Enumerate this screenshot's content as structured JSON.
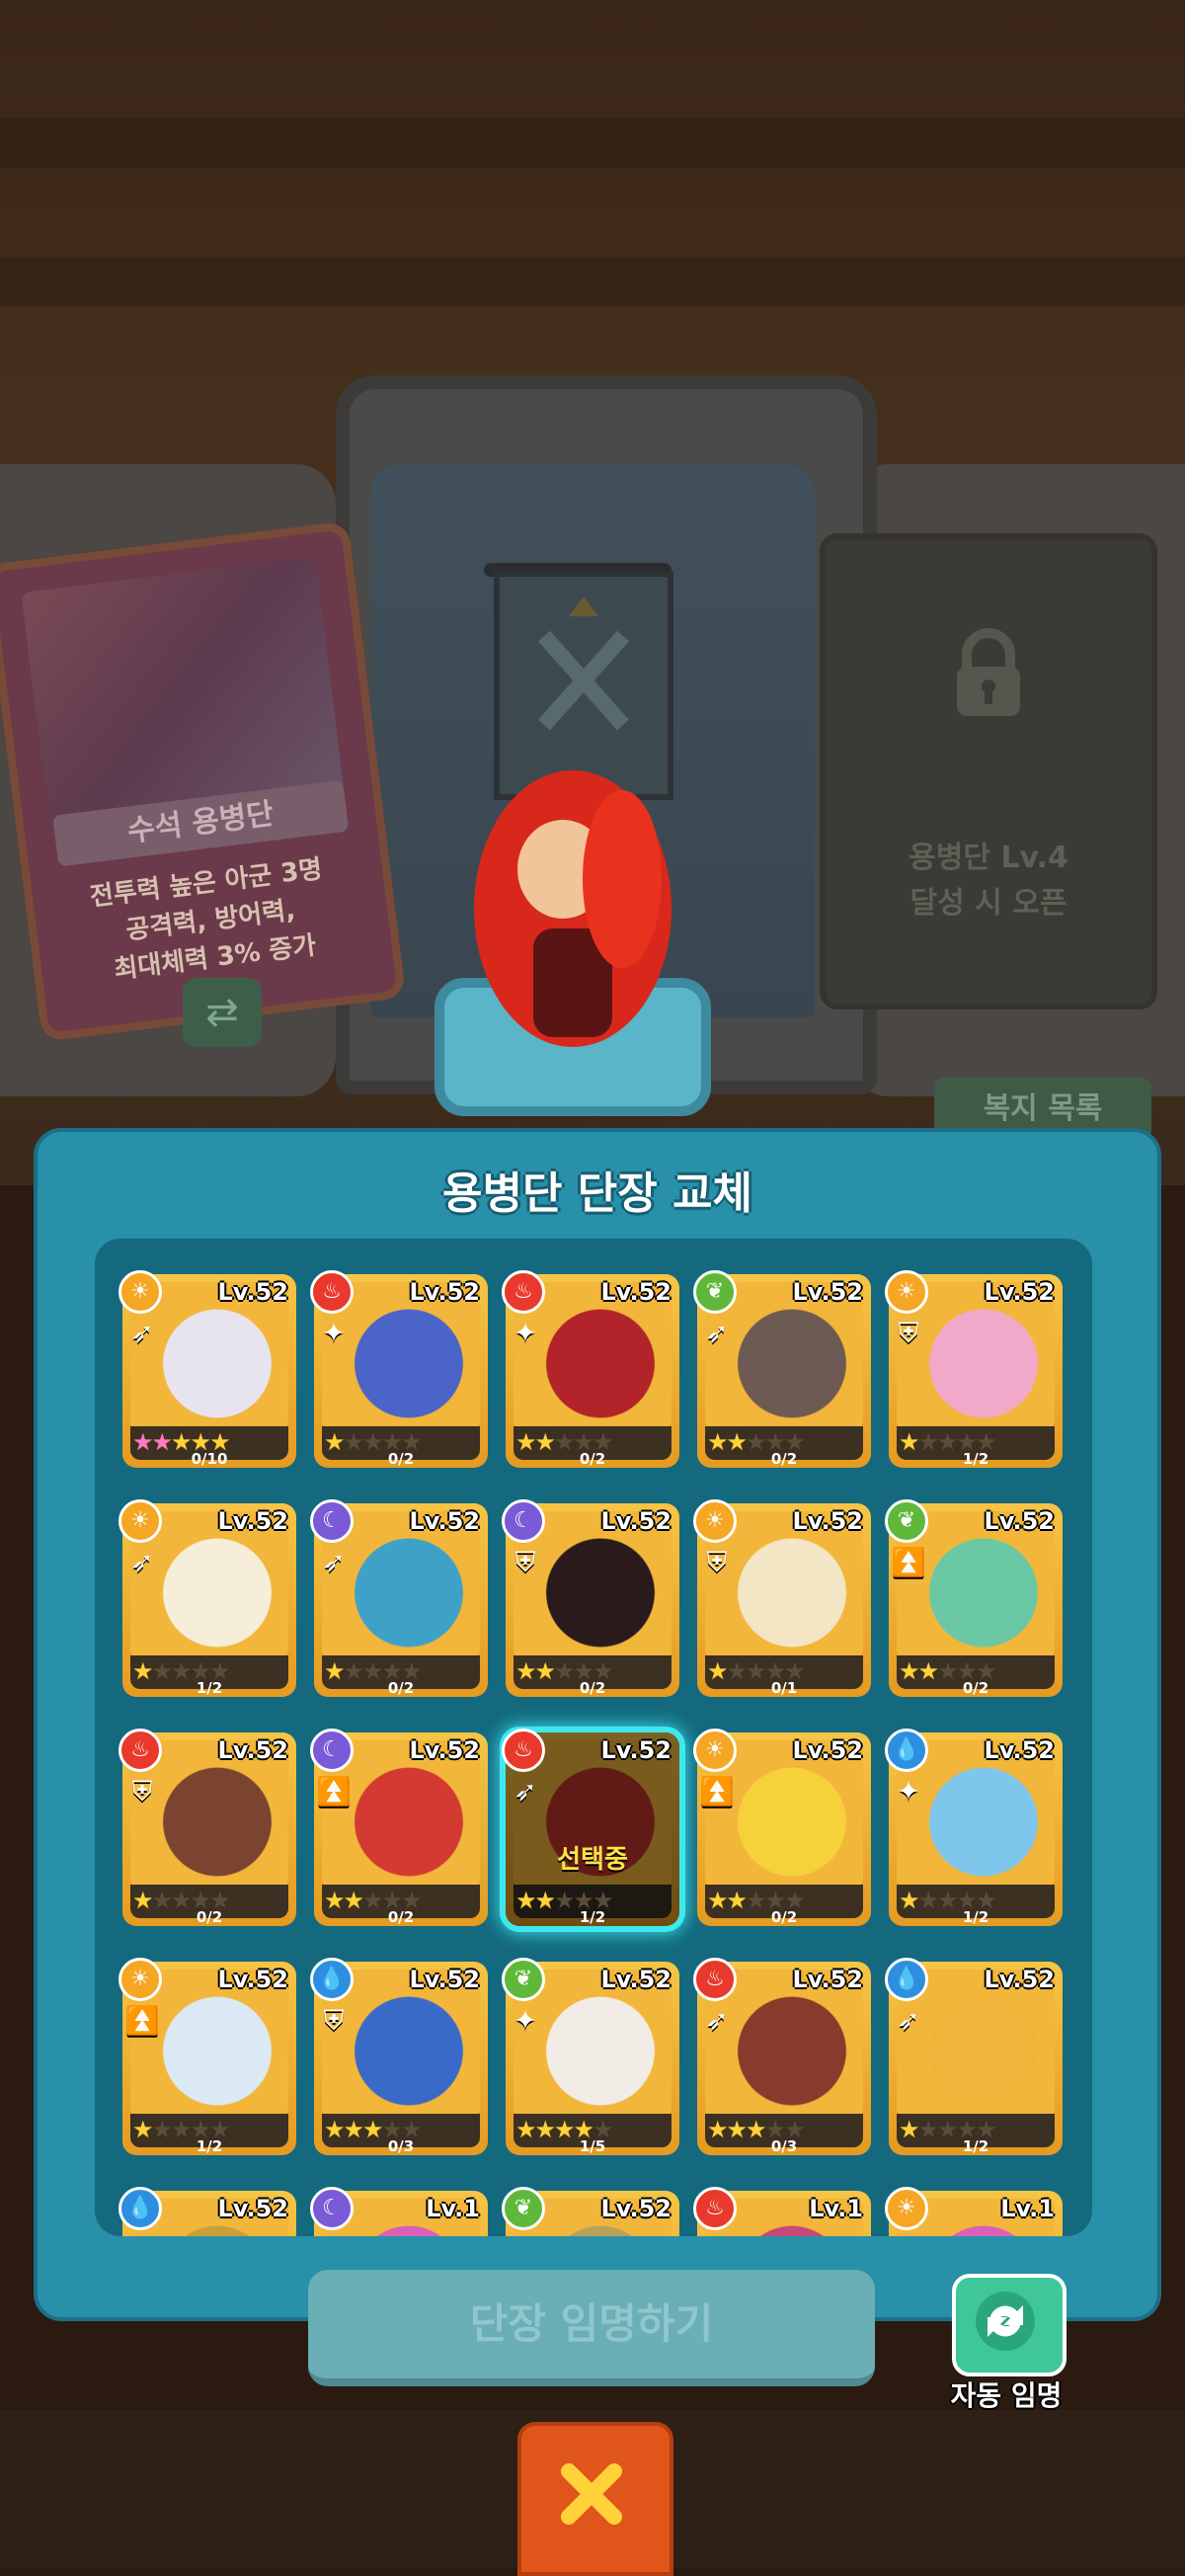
{
  "background": {
    "left_card": {
      "title": "수석 용병단",
      "desc_lines": [
        "전투력 높은 아군 3명",
        "공격력, 방어력,",
        "최대체력 3% 증가"
      ]
    },
    "right_card": {
      "lines": [
        "용병단 Lv.4",
        "달성 시 오픈"
      ]
    },
    "support_list_label": "복지 목록"
  },
  "popup": {
    "title": "용병단 단장 교체",
    "appoint_button": "단장 임명하기",
    "auto_appoint_label": "자동 임명",
    "selected_label": "선택중"
  },
  "element_colors": {
    "light": "#f5a623",
    "fire": "#e8392c",
    "earth": "#5fb83a",
    "dark": "#7a5ad6",
    "water": "#2e8fe0"
  },
  "cookies": [
    {
      "element": "light",
      "role": "ranged",
      "level": "Lv.52",
      "stars": 5,
      "pink_stars": 2,
      "shards": "0/10",
      "tint": "#e8e4ef"
    },
    {
      "element": "fire",
      "role": "magic",
      "level": "Lv.52",
      "stars": 1,
      "pink_stars": 0,
      "shards": "0/2",
      "tint": "#4a64c8"
    },
    {
      "element": "fire",
      "role": "magic",
      "level": "Lv.52",
      "stars": 2,
      "pink_stars": 0,
      "shards": "0/2",
      "tint": "#b2242a"
    },
    {
      "element": "earth",
      "role": "ranged",
      "level": "Lv.52",
      "stars": 2,
      "pink_stars": 0,
      "shards": "0/2",
      "tint": "#6d5a52"
    },
    {
      "element": "light",
      "role": "defense",
      "level": "Lv.52",
      "stars": 1,
      "pink_stars": 0,
      "shards": "1/2",
      "tint": "#f1a9c9"
    },
    {
      "element": "light",
      "role": "ranged",
      "level": "Lv.52",
      "stars": 1,
      "pink_stars": 0,
      "shards": "1/2",
      "tint": "#f6eed8"
    },
    {
      "element": "dark",
      "role": "ranged",
      "level": "Lv.52",
      "stars": 1,
      "pink_stars": 0,
      "shards": "0/2",
      "tint": "#3ea2c8"
    },
    {
      "element": "dark",
      "role": "defense",
      "level": "Lv.52",
      "stars": 2,
      "pink_stars": 0,
      "shards": "0/2",
      "tint": "#2a1a1c"
    },
    {
      "element": "light",
      "role": "defense",
      "level": "Lv.52",
      "stars": 1,
      "pink_stars": 0,
      "shards": "0/1",
      "tint": "#f3e6c4"
    },
    {
      "element": "earth",
      "role": "charge",
      "level": "Lv.52",
      "stars": 2,
      "pink_stars": 0,
      "shards": "0/2",
      "tint": "#6ac8a4"
    },
    {
      "element": "fire",
      "role": "defense",
      "level": "Lv.52",
      "stars": 1,
      "pink_stars": 0,
      "shards": "0/2",
      "tint": "#7a4430"
    },
    {
      "element": "dark",
      "role": "charge",
      "level": "Lv.52",
      "stars": 2,
      "pink_stars": 0,
      "shards": "0/2",
      "tint": "#d23a32"
    },
    {
      "element": "fire",
      "role": "ranged",
      "level": "Lv.52",
      "stars": 2,
      "pink_stars": 0,
      "shards": "1/2",
      "tint": "#c4342c",
      "selected": true
    },
    {
      "element": "light",
      "role": "charge",
      "level": "Lv.52",
      "stars": 2,
      "pink_stars": 0,
      "shards": "0/2",
      "tint": "#f6d23a"
    },
    {
      "element": "water",
      "role": "magic",
      "level": "Lv.52",
      "stars": 1,
      "pink_stars": 0,
      "shards": "1/2",
      "tint": "#7ec6ec"
    },
    {
      "element": "light",
      "role": "charge",
      "level": "Lv.52",
      "stars": 1,
      "pink_stars": 0,
      "shards": "1/2",
      "tint": "#dbe9f5"
    },
    {
      "element": "water",
      "role": "defense",
      "level": "Lv.52",
      "stars": 3,
      "pink_stars": 0,
      "shards": "0/3",
      "tint": "#3a6ac8"
    },
    {
      "element": "earth",
      "role": "magic",
      "level": "Lv.52",
      "stars": 4,
      "pink_stars": 0,
      "shards": "1/5",
      "tint": "#f2ece6"
    },
    {
      "element": "fire",
      "role": "ranged",
      "level": "Lv.52",
      "stars": 3,
      "pink_stars": 0,
      "shards": "0/3",
      "tint": "#8a3a2c"
    },
    {
      "element": "water",
      "role": "ranged",
      "level": "Lv.52",
      "stars": 1,
      "pink_stars": 0,
      "shards": "1/2",
      "tint": "#f0b43a"
    },
    {
      "element": "water",
      "role": "",
      "level": "Lv.52",
      "tint": "#c8a03a"
    },
    {
      "element": "dark",
      "role": "",
      "level": "Lv.1",
      "tint": "#d860b8"
    },
    {
      "element": "earth",
      "role": "",
      "level": "Lv.52",
      "tint": "#b8a25a"
    },
    {
      "element": "fire",
      "role": "",
      "level": "Lv.1",
      "tint": "#c84878"
    },
    {
      "element": "light",
      "role": "",
      "level": "Lv.1",
      "tint": "#d860b8"
    }
  ]
}
